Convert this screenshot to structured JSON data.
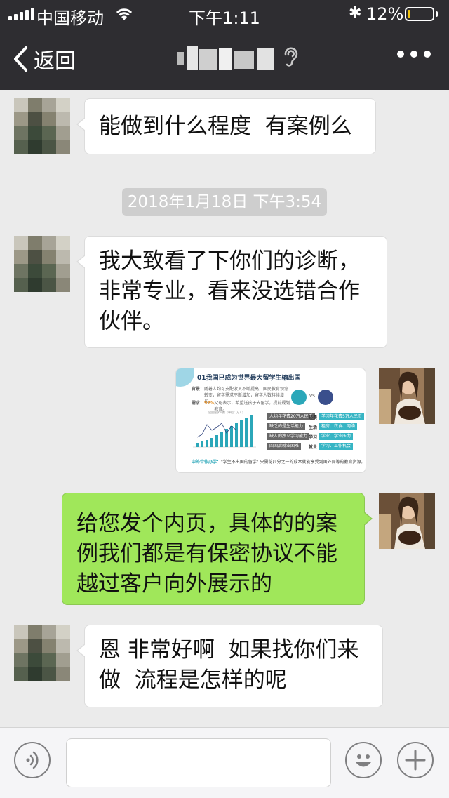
{
  "status_bar": {
    "carrier": "中国移动",
    "time": "下午1:11",
    "battery_percent": "12%",
    "battery_level": 0.12,
    "icons": [
      "signal-icon",
      "wifi-icon",
      "bluetooth-icon",
      "battery-icon"
    ]
  },
  "nav": {
    "back_label": "返回",
    "title_blurred": true,
    "icons": [
      "chevron-left-icon",
      "ear-icon",
      "more-icon"
    ]
  },
  "messages": [
    {
      "side": "left",
      "text": "能做到什么程度  有案例么"
    },
    {
      "type": "timestamp",
      "text": "2018年1月18日 下午3:54"
    },
    {
      "side": "left",
      "lines": [
        "我大致看了下你们的诊断，",
        "非常专业，看来没选错合作",
        "伙伴。"
      ]
    },
    {
      "side": "right",
      "type": "image",
      "slide": {
        "title": "01我国已成为世界最大留学生输出国",
        "para1_label": "背景：",
        "para1": "随着人均可支配收入不断提高，国民教育观念转变，留学需求不断增加，留学人数持续增长。",
        "para2_label": "需求：",
        "para2_highlight": "92%",
        "para2": "父母表示，希望送孩子去留学，提前规划教育。",
        "vs": "VS",
        "tags_left": [
          "人均年花费20万人民币",
          "缺乏的是生活能力",
          "缺人的独立学习能力",
          "回国后就业困难"
        ],
        "tag_keys": [
          "经费",
          "生活",
          "学习",
          "就业"
        ],
        "tags_right": [
          "学习年花费5万人民币",
          "租房、衣食、网购",
          "学业、学业压力",
          "学习、工作机会"
        ],
        "chart_caption": "出国留学人数（单位：万人）",
        "footer_label": "中外合作办学：",
        "footer_text": "\"学生不出国的留学\" 只需花四分之一的成本就能享受到国外同等的教育资源。"
      }
    },
    {
      "side": "right",
      "lines": [
        "给您发个内页，具体的的案",
        "例我们都是有保密协议不能",
        "越过客户向外展示的"
      ]
    },
    {
      "side": "left",
      "lines": [
        "恩 非常好啊  如果找你们来",
        "做  流程是怎样的呢"
      ]
    }
  ],
  "input_bar": {
    "placeholder": "",
    "icons": [
      "voice-icon",
      "emoji-icon",
      "plus-icon"
    ]
  }
}
